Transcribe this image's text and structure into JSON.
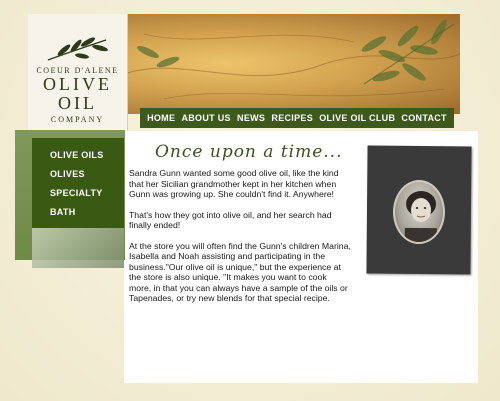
{
  "logo": {
    "line1": "COEUR D'ALENE",
    "line2": "OLIVE",
    "line3": "OIL",
    "line4": "COMPANY"
  },
  "nav": {
    "items": [
      {
        "label": "HOME"
      },
      {
        "label": "ABOUT US"
      },
      {
        "label": "NEWS"
      },
      {
        "label": "RECIPES"
      },
      {
        "label": "OLIVE OIL CLUB"
      },
      {
        "label": "CONTACT"
      }
    ]
  },
  "sidebar": {
    "items": [
      {
        "label": "OLIVE OILS"
      },
      {
        "label": "OLIVES"
      },
      {
        "label": "SPECIALTY"
      },
      {
        "label": "BATH"
      }
    ]
  },
  "main": {
    "title": "Once upon a time...",
    "paragraphs": [
      "Sandra Gunn wanted some good olive oil, like the kind that her Sicilian grandmother kept in her kitchen when Gunn was growing up. She couldn't find it. Anywhere!",
      "That's how they got into olive oil, and her search had finally ended!",
      "At the store you will often find the Gunn's children Marina, Isabella and Noah assisting and participating in the business.\"Our olive oil is unique,\" but the experience at the store is also unique. \"It makes you want to cook more, in that you can always have a sample of the oils or Tapenades, or try new blends for that special recipe."
    ]
  },
  "colors": {
    "nav_green": "#3d5a1c",
    "sidebar_green": "#3a5a14",
    "page_bg": "#f4efd8",
    "title_green": "#3c4f1e"
  }
}
